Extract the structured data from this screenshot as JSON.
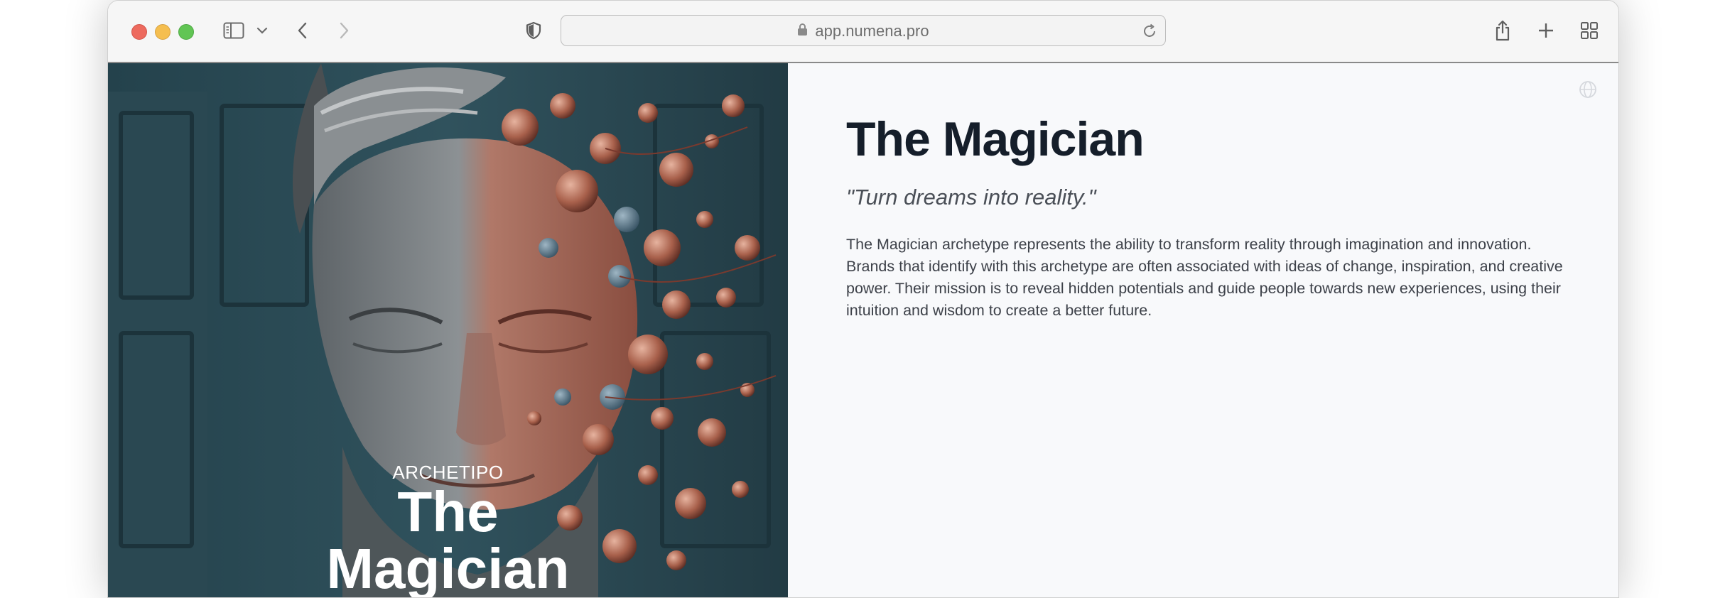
{
  "browser": {
    "url": "app.numena.pro",
    "icons": {
      "sidebar": "sidebar-icon",
      "chevron": "chevron-down-icon",
      "back": "back-arrow-icon",
      "forward": "forward-arrow-icon",
      "privacy": "shield-icon",
      "lock": "lock-icon",
      "reload": "reload-icon",
      "share": "share-icon",
      "new_tab": "plus-icon",
      "tabs": "tab-overview-icon"
    }
  },
  "hero": {
    "kicker": "ARCHETIPO",
    "title_line1": "The",
    "title_line2": "Magician"
  },
  "panel": {
    "title": "The Magician",
    "quote": "\"Turn dreams into reality.\"",
    "description": "The Magician archetype represents the ability to transform reality through imagination and innovation. Brands that identify with this archetype are often associated with ideas of change, inspiration, and creative power. Their mission is to reveal hidden potentials and guide people towards new experiences, using their intuition and wisdom to create a better future.",
    "globe_icon": "globe-icon"
  },
  "colors": {
    "title": "#151e2a",
    "hero_background": "#2c4a55",
    "panel_background": "#f8f9fb"
  }
}
